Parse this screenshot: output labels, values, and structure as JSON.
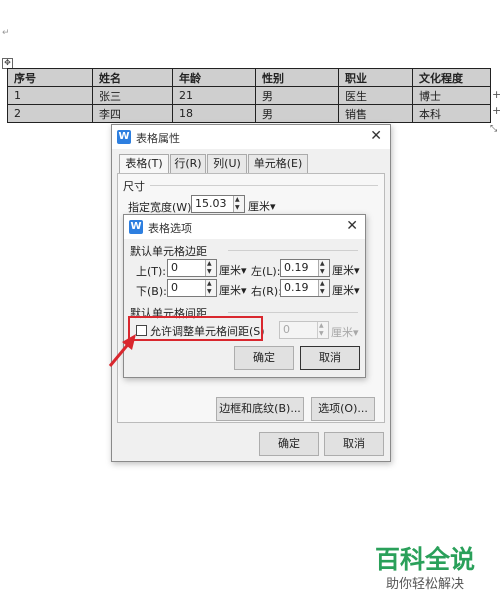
{
  "document": {
    "table": {
      "headers": [
        "序号",
        "姓名",
        "年龄",
        "性别",
        "职业",
        "文化程度"
      ],
      "rows": [
        [
          "1",
          "张三",
          "21",
          "男",
          "医生",
          "博士"
        ],
        [
          "2",
          "李四",
          "18",
          "男",
          "销售",
          "本科"
        ]
      ]
    },
    "move_handle_icon": "move-icon",
    "add_column_icon": "plus-icon"
  },
  "table_properties": {
    "title": "表格属性",
    "tabs": [
      "表格(T)",
      "行(R)",
      "列(U)",
      "单元格(E)"
    ],
    "active_tab": 0,
    "size_section": "尺寸",
    "width_label": "指定宽度(W):",
    "width_value": "15.03",
    "width_unit": "厘米▾",
    "borders_button": "边框和底纹(B)...",
    "options_button": "选项(O)...",
    "ok": "确定",
    "cancel": "取消"
  },
  "table_options": {
    "title": "表格选项",
    "margins_section": "默认单元格边距",
    "top_label": "上(T):",
    "top_value": "0",
    "left_label": "左(L):",
    "left_value": "0.19",
    "bottom_label": "下(B):",
    "bottom_value": "0",
    "right_label": "右(R):",
    "right_value": "0.19",
    "unit": "厘米▾",
    "spacing_section": "默认单元格间距",
    "allow_spacing_label": "允许调整单元格间距(S)",
    "allow_spacing_checked": false,
    "spacing_value": "0",
    "spacing_unit": "厘米▾",
    "ok": "确定",
    "cancel": "取消"
  },
  "colors": {
    "highlight_box": "#d9272e",
    "arrow": "#d9272e",
    "watermark_green": "#2aa05a",
    "app_accent": "#2d7fe0"
  },
  "watermark": {
    "title": "百科全说",
    "subtitle": "助你轻松解决"
  }
}
